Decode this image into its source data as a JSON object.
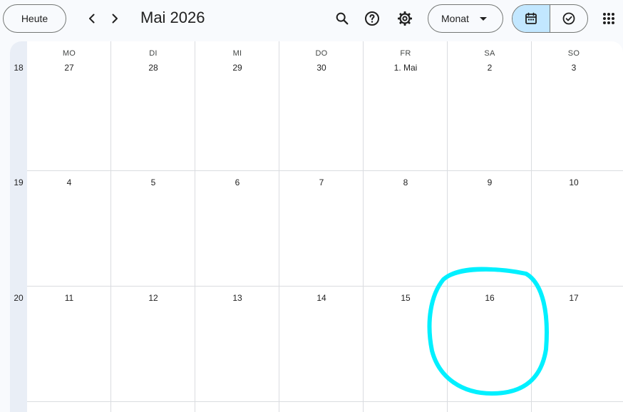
{
  "toolbar": {
    "today_label": "Heute",
    "prev_icon": "chevron-left-icon",
    "next_icon": "chevron-right-icon",
    "title": "Mai 2026",
    "view_label": "Monat",
    "icons": [
      "search-icon",
      "help-icon",
      "settings-icon",
      "calendar-icon",
      "tasks-check-icon",
      "apps-grid-icon"
    ]
  },
  "calendar": {
    "weekdays": [
      "MO",
      "DI",
      "MI",
      "DO",
      "FR",
      "SA",
      "SO"
    ],
    "weeks": [
      {
        "number": "18",
        "days": [
          "27",
          "28",
          "29",
          "30",
          "1. Mai",
          "2",
          "3"
        ]
      },
      {
        "number": "19",
        "days": [
          "4",
          "5",
          "6",
          "7",
          "8",
          "9",
          "10"
        ]
      },
      {
        "number": "20",
        "days": [
          "11",
          "12",
          "13",
          "14",
          "15",
          "16",
          "17"
        ]
      }
    ]
  },
  "annotation": {
    "color": "#00f0ff",
    "target_day": "16"
  },
  "colors": {
    "accent_selected": "#c2e7ff",
    "background": "#f8fafd",
    "week_column": "#e9eef6",
    "grid": "#dadce0"
  }
}
